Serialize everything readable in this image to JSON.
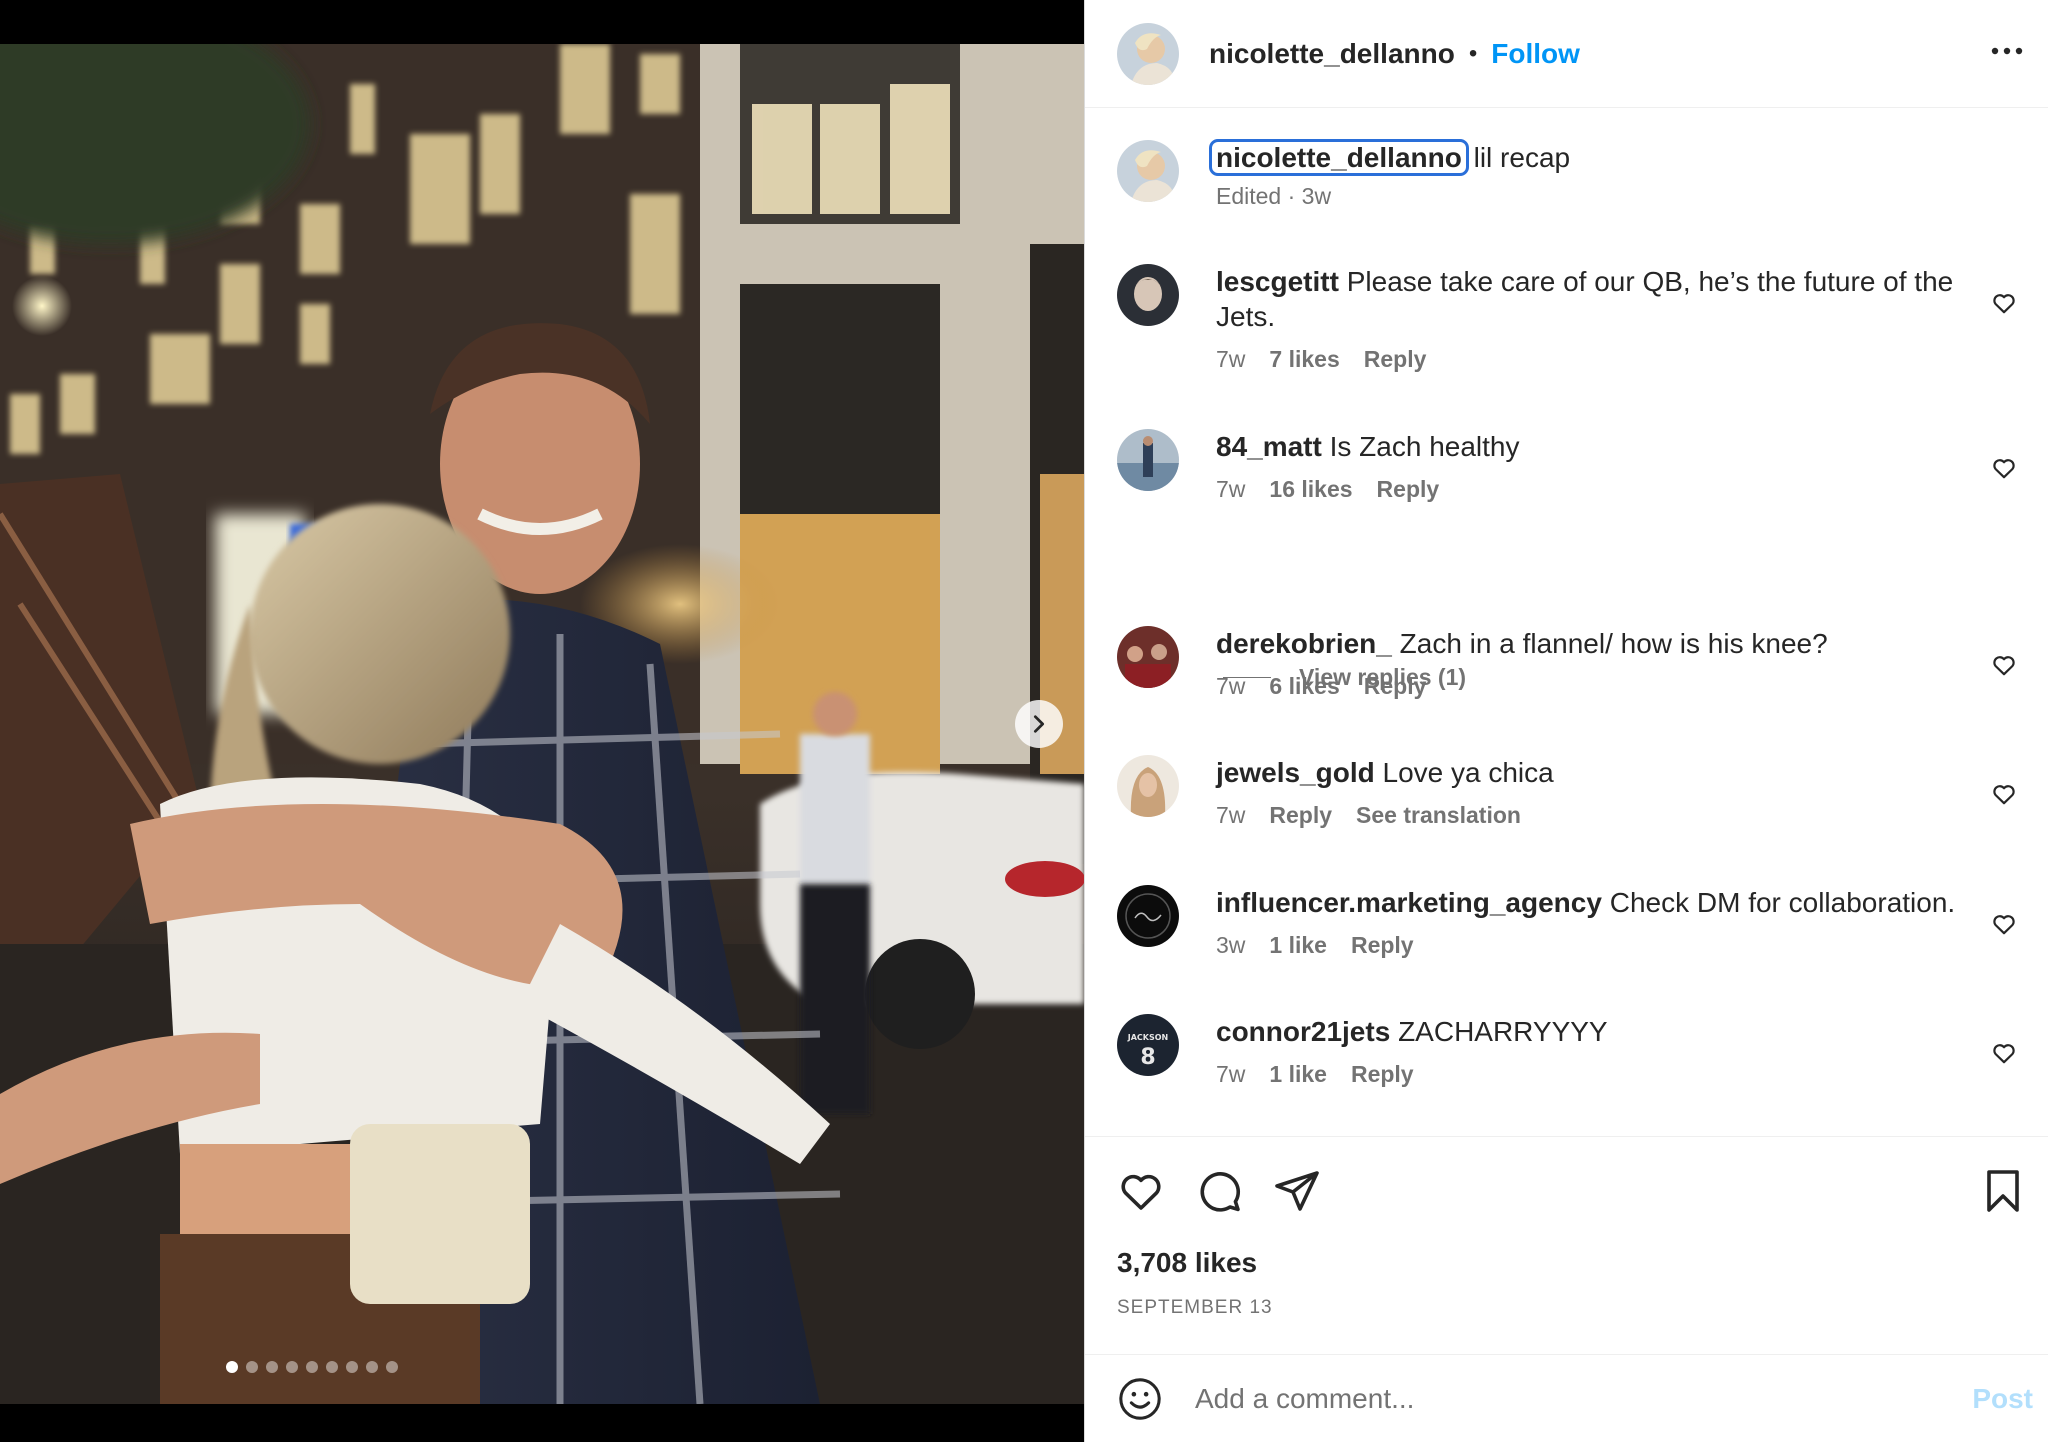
{
  "post": {
    "author": "nicolette_dellanno",
    "separator": "•",
    "follow_label": "Follow",
    "caption": "lil recap",
    "caption_meta": "Edited · 3w",
    "likes": "3,708 likes",
    "date": "SEPTEMBER 13",
    "carousel": {
      "total": 9,
      "active": 1
    }
  },
  "comments": [
    {
      "user": "lescgetitt",
      "text": "Please take care of our QB, he’s the future of the Jets.",
      "time": "7w",
      "likes": "7 likes",
      "reply": "Reply",
      "avatar_color": "#2b2f36"
    },
    {
      "user": "84_matt",
      "text": "Is Zach healthy",
      "time": "7w",
      "likes": "16 likes",
      "reply": "Reply",
      "avatar_color": "#6f8aa3"
    },
    {
      "user": "derekobrien_",
      "text": "Zach in a flannel/ how is his knee?",
      "time": "7w",
      "likes": "6 likes",
      "reply": "Reply",
      "avatar_color": "#6d2f2a"
    },
    {
      "user": "jewels_gold",
      "text": "Love ya chica",
      "time": "7w",
      "reply": "Reply",
      "translate": "See translation",
      "avatar_color": "#c9a27a"
    },
    {
      "user": "influencer.marketing_agency",
      "text": "Check DM for collaboration.",
      "time": "3w",
      "likes": "1 like",
      "reply": "Reply",
      "avatar_color": "#0c0c0c"
    },
    {
      "user": "connor21jets",
      "text": "ZACHARRYYYY",
      "time": "7w",
      "likes": "1 like",
      "reply": "Reply",
      "avatar_color": "#1c2430",
      "avatar_text": "JACKSON",
      "avatar_number": "8"
    }
  ],
  "view_replies": "View replies (1)",
  "composer": {
    "placeholder": "Add a comment...",
    "post_label": "Post"
  },
  "colors": {
    "accent": "#0095f6",
    "secondary_text": "#737373",
    "post_disabled": "#b2dffc"
  },
  "icons": {
    "more": "more-options-icon",
    "next": "chevron-right-icon",
    "like": "heart-icon",
    "comment": "comment-icon",
    "share": "send-icon",
    "save": "bookmark-icon",
    "emoji": "emoji-icon"
  }
}
